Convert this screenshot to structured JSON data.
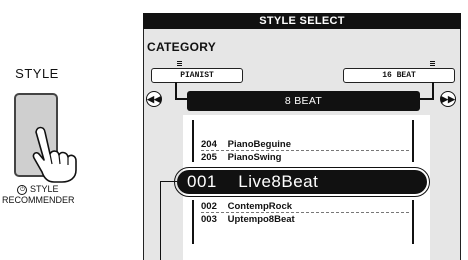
{
  "panel": {
    "title": "STYLE",
    "recommender_icon": "⏻",
    "recommender_line1": "STYLE",
    "recommender_line2": "RECOMMENDER"
  },
  "display": {
    "header": "STYLE SELECT",
    "category_label": "CATEGORY",
    "prev_category": "PIANIST",
    "next_category": "16 BEAT",
    "current_category": "8 BEAT",
    "list": [
      {
        "num": "204",
        "name": "PianoBeguine"
      },
      {
        "num": "205",
        "name": "PianoSwing"
      }
    ],
    "selected": {
      "num": "001",
      "name": "Live8Beat"
    },
    "list_after": [
      {
        "num": "002",
        "name": "ContempRock"
      },
      {
        "num": "003",
        "name": "Uptempo8Beat"
      }
    ]
  }
}
